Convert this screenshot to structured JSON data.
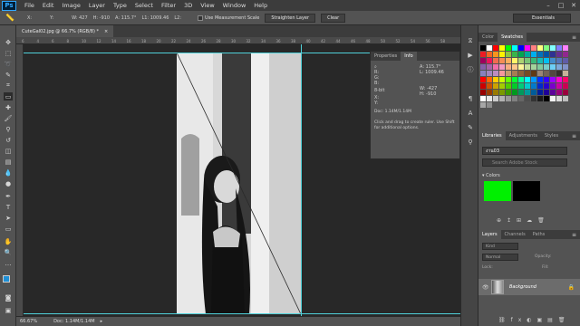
{
  "menubar": {
    "logo": "Ps",
    "items": [
      "File",
      "Edit",
      "Image",
      "Layer",
      "Type",
      "Select",
      "Filter",
      "3D",
      "View",
      "Window",
      "Help"
    ],
    "window_controls": [
      "–",
      "□",
      "✕"
    ]
  },
  "options": {
    "x": "X:",
    "y": "Y:",
    "w": "W: 427",
    "h": "H: -910",
    "a": "A: 115.7°",
    "l1": "L1: 1009.46",
    "l2": "L2:",
    "use_measurement": "Use Measurement Scale",
    "straighten": "Straighten Layer",
    "clear": "Clear",
    "workspace": "Essentials"
  },
  "document": {
    "tab_title": "CuteGal02.jpg @ 66.7% (RGB/8) *",
    "ruler_ticks": [
      "6",
      "4",
      "6",
      "8",
      "10",
      "12",
      "14",
      "16",
      "18",
      "20",
      "22",
      "24",
      "26",
      "28",
      "30",
      "32",
      "34",
      "36",
      "38",
      "40",
      "42",
      "44",
      "46",
      "48",
      "50",
      "52",
      "54",
      "56",
      "58"
    ],
    "zoom": "66.67%",
    "doc_size": "Doc: 1.14M/1.14M"
  },
  "info_panel": {
    "tabs": [
      "Properties",
      "Info"
    ],
    "r": "R:",
    "g": "G:",
    "b": "B:",
    "a_label": "A:",
    "a_val": "115.7°",
    "l_label": "L:",
    "l_val": "1009.46",
    "bit": "8-bit",
    "x": "X:",
    "y": "Y:",
    "w_label": "W:",
    "w_val": "-427",
    "h_label": "H:",
    "h_val": "-910",
    "doc": "Doc: 1.14M/1.14M",
    "hint": "Click and drag to create ruler. Use Shift for additional options."
  },
  "color_panel": {
    "tabs": [
      "Color",
      "Swatches"
    ],
    "swatch_colors": [
      "#000000",
      "#ffffff",
      "#ff0000",
      "#ffff00",
      "#00ff00",
      "#00ffff",
      "#0000ff",
      "#ff00ff",
      "#ff8080",
      "#ffff80",
      "#80ff80",
      "#80ffff",
      "#8080ff",
      "#ff80ff",
      "#ed1c24",
      "#f26522",
      "#f7941d",
      "#fff200",
      "#8dc63f",
      "#39b54a",
      "#00a651",
      "#00a99d",
      "#00aeef",
      "#0072bc",
      "#0054a6",
      "#2e3192",
      "#662d91",
      "#92278f",
      "#9e005d",
      "#ed145b",
      "#f26c4f",
      "#f68e56",
      "#fbaf5d",
      "#fff568",
      "#acd372",
      "#7cc576",
      "#3bb878",
      "#1abbb4",
      "#00bff3",
      "#438ccb",
      "#5574b9",
      "#605ca8",
      "#855fa8",
      "#a763a8",
      "#f06ea9",
      "#f49ac2",
      "#f9ad81",
      "#fdc68a",
      "#fff799",
      "#c4df9b",
      "#a3d39c",
      "#82ca9c",
      "#7accc8",
      "#6dcff6",
      "#7da7d9",
      "#8393ca",
      "#8781bd",
      "#a186be",
      "#bd8cbf",
      "#f5989d",
      "#c69c6d",
      "#a67c52",
      "#8c6239",
      "#754c24",
      "#603913",
      "#998675",
      "#736357",
      "#534741",
      "#362f2d",
      "#c7b299",
      "#ff0000",
      "#ff6600",
      "#ffcc00",
      "#ccff00",
      "#66ff00",
      "#00ff33",
      "#00ff99",
      "#00ffff",
      "#0099ff",
      "#0033ff",
      "#3300ff",
      "#9900ff",
      "#ff00cc",
      "#ff0066",
      "#cc0000",
      "#cc5200",
      "#cca300",
      "#a3cc00",
      "#52cc00",
      "#00cc29",
      "#00cc7a",
      "#00cccc",
      "#007acc",
      "#0029cc",
      "#2900cc",
      "#7a00cc",
      "#cc00a3",
      "#cc0052",
      "#990000",
      "#993d00",
      "#997a00",
      "#7a9900",
      "#3d9900",
      "#00991f",
      "#00995c",
      "#009999",
      "#005c99",
      "#001f99",
      "#1f0099",
      "#5c0099",
      "#99007a",
      "#99003d",
      "#ffffff",
      "#e6e6e6",
      "#cccccc",
      "#b3b3b3",
      "#999999",
      "#808080",
      "#666666",
      "#4d4d4d",
      "#333333",
      "#1a1a1a",
      "#000000",
      "#f2f2f2",
      "#d9d9d9",
      "#bfbfbf",
      "#a6a6a6",
      "#8c8c8c"
    ]
  },
  "libraries": {
    "tabs": [
      "Libraries",
      "Adjustments",
      "Styles"
    ],
    "selected": "งาน03",
    "search_placeholder": "Search Adobe Stock",
    "colors_label": "Colors",
    "swatch_green": "#00f000",
    "swatch_black": "#000000"
  },
  "layers": {
    "tabs": [
      "Layers",
      "Channels",
      "Paths"
    ],
    "kind": "Kind",
    "blend": "Normal",
    "opacity": "Opacity:",
    "lock": "Lock:",
    "fill": "Fill:",
    "layer_name": "Background"
  }
}
